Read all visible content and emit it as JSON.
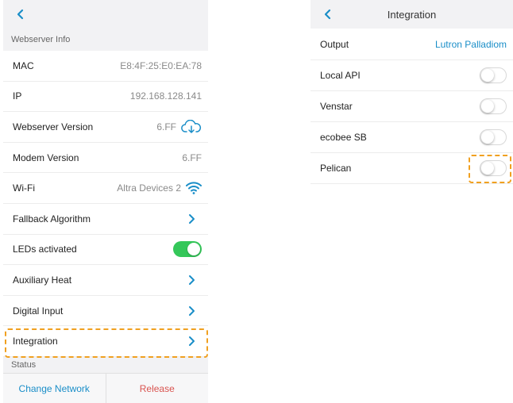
{
  "left": {
    "section_title": "Webserver Info",
    "rows": [
      {
        "label": "MAC",
        "value": "E8:4F:25:E0:EA:78"
      },
      {
        "label": "IP",
        "value": "192.168.128.141"
      },
      {
        "label": "Webserver Version",
        "value": "6.FF"
      },
      {
        "label": "Modem Version",
        "value": "6.FF"
      },
      {
        "label": "Wi-Fi",
        "value": "Altra Devices 2"
      },
      {
        "label": "Fallback Algorithm"
      },
      {
        "label": "LEDs activated"
      },
      {
        "label": "Auxiliary Heat"
      },
      {
        "label": "Digital Input"
      },
      {
        "label": "Integration"
      }
    ],
    "status_label": "Status",
    "change_network_label": "Change Network",
    "release_label": "Release"
  },
  "right": {
    "title": "Integration",
    "output_label": "Output",
    "output_value": "Lutron Palladiom",
    "rows": [
      {
        "label": "Local API"
      },
      {
        "label": "Venstar"
      },
      {
        "label": "ecobee SB"
      },
      {
        "label": "Pelican"
      }
    ]
  },
  "colors": {
    "accent": "#1a8ec8",
    "toggle_on": "#34c759",
    "highlight": "#f0a020",
    "danger": "#d9534f"
  }
}
